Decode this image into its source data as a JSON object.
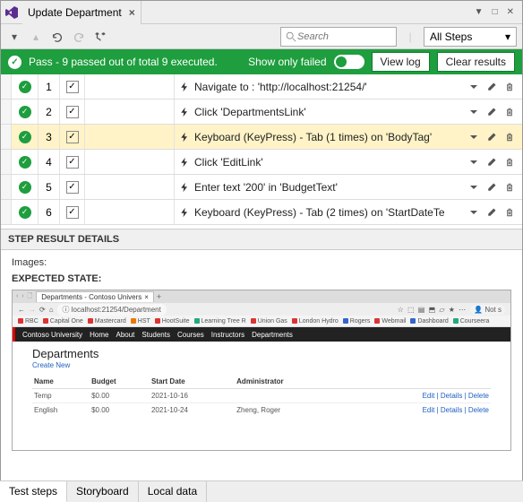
{
  "window": {
    "title": "Update Department"
  },
  "toolbar": {
    "search_placeholder": "Search",
    "steps_filter": "All Steps"
  },
  "passbar": {
    "text": "Pass - 9 passed out of total 9 executed.",
    "show_only_failed": "Show only failed",
    "view_log": "View log",
    "clear_results": "Clear results"
  },
  "steps": [
    {
      "num": "1",
      "desc": "Navigate to : 'http://localhost:21254/'"
    },
    {
      "num": "2",
      "desc": "Click 'DepartmentsLink'"
    },
    {
      "num": "3",
      "desc": "Keyboard (KeyPress) - Tab (1 times) on 'BodyTag'",
      "highlight": true
    },
    {
      "num": "4",
      "desc": "Click 'EditLink'"
    },
    {
      "num": "5",
      "desc": "Enter text '200' in 'BudgetText'"
    },
    {
      "num": "6",
      "desc": "Keyboard (KeyPress) - Tab (2 times) on 'StartDateTe"
    }
  ],
  "details": {
    "header": "STEP RESULT DETAILS",
    "images_label": "Images:",
    "expected_label": "EXPECTED STATE:"
  },
  "preview": {
    "tab_title": "Departments - Contoso Univers",
    "url": "localhost:21254/Department",
    "not": "Not s",
    "bookmarks": [
      "RBC",
      "Capital One",
      "Mastercard",
      "HST",
      "HootSuite",
      "Learning Tree R",
      "Union Gas",
      "London Hydro",
      "Rogers",
      "Webmail",
      "Dashboard",
      "Courseera"
    ],
    "nav_brand": "Contoso University",
    "nav_items": [
      "Home",
      "About",
      "Students",
      "Courses",
      "Instructors",
      "Departments"
    ],
    "page_title": "Departments",
    "create_new": "Create New",
    "cols": [
      "Name",
      "Budget",
      "Start Date",
      "Administrator"
    ],
    "rows": [
      {
        "name": "Temp",
        "budget": "$0.00",
        "date": "2021-10-16",
        "admin": ""
      },
      {
        "name": "English",
        "budget": "$0.00",
        "date": "2021-10-24",
        "admin": "Zheng, Roger"
      }
    ],
    "row_actions": "Edit | Details | Delete"
  },
  "bottom_tabs": [
    "Test steps",
    "Storyboard",
    "Local data"
  ]
}
